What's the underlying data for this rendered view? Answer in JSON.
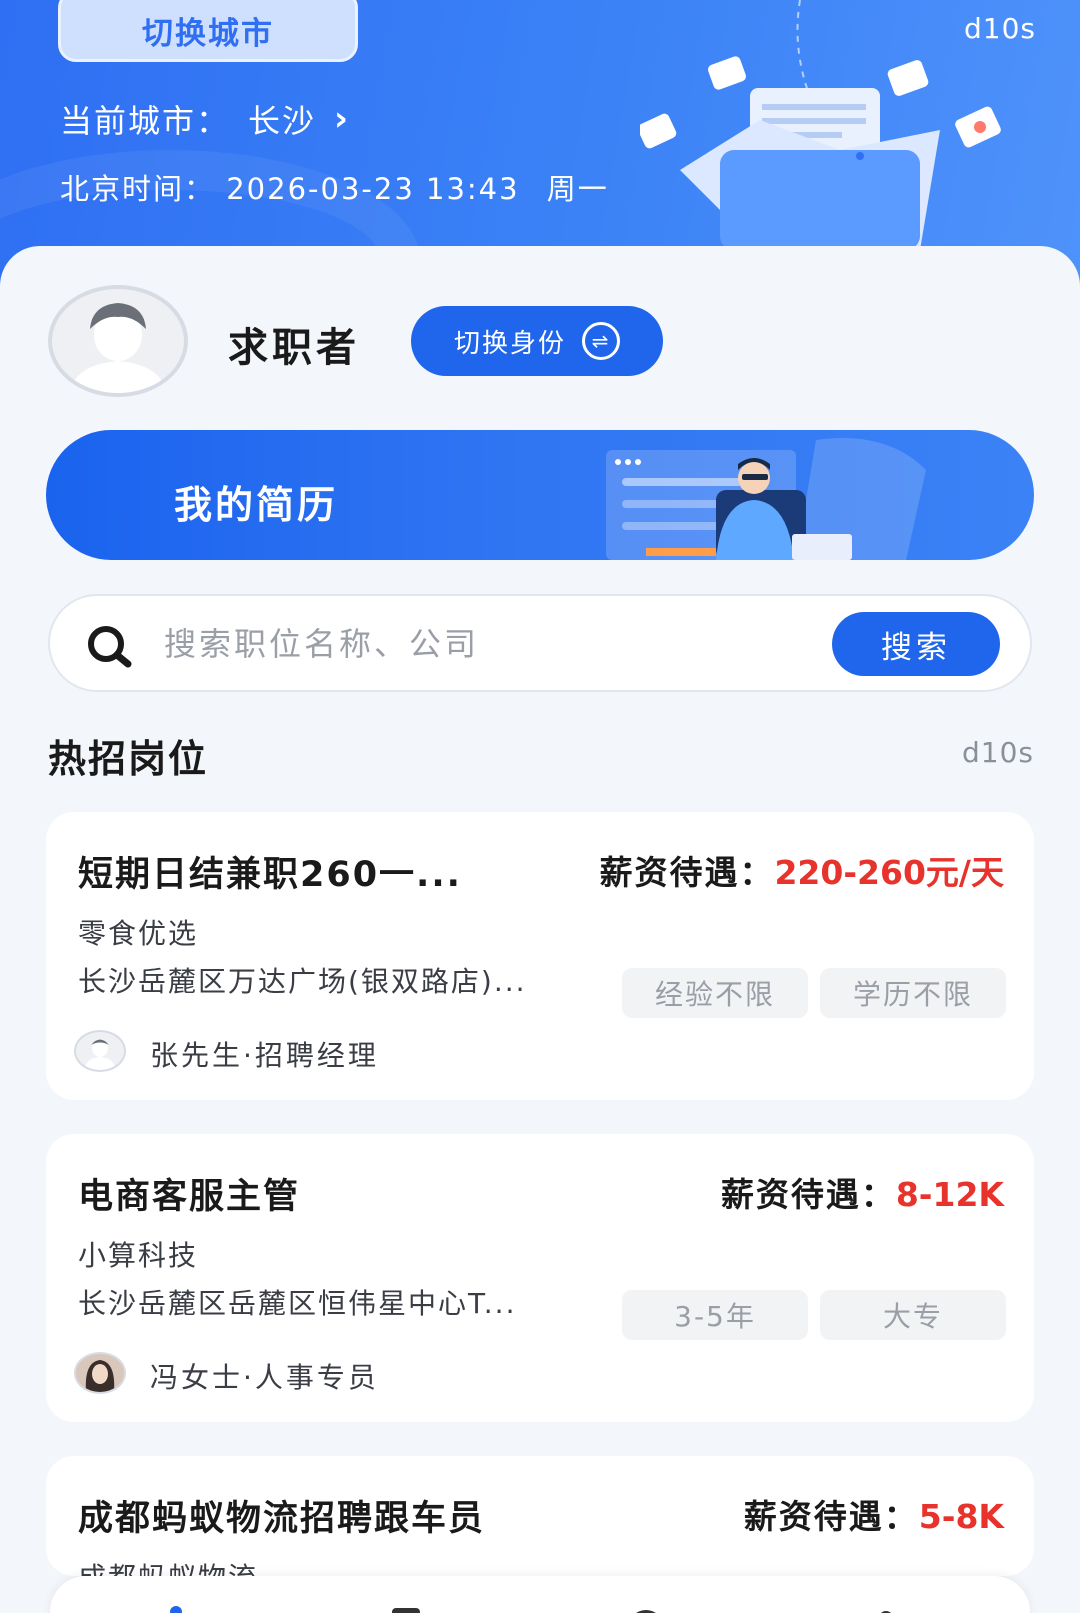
{
  "header": {
    "switch_city_label": "切换城市",
    "code": "d10s",
    "current_city_label": "当前城市：",
    "current_city": "长沙",
    "time_label": "北京时间：",
    "datetime": "2026-03-23 13:43",
    "weekday": "周一"
  },
  "profile": {
    "role": "求职者",
    "switch_identity_label": "切换身份"
  },
  "resume_banner": {
    "label": "我的简历"
  },
  "search": {
    "placeholder": "搜索职位名称、公司",
    "button_label": "搜索"
  },
  "hot_jobs": {
    "title": "热招岗位",
    "code": "d10s",
    "salary_label": "薪资待遇：",
    "jobs": [
      {
        "title": "短期日结兼职260一...",
        "salary": "220-260元/天",
        "company": "零食优选",
        "address": "长沙岳麓区万达广场(银双路店)...",
        "tags": [
          "经验不限",
          "学历不限"
        ],
        "recruiter": "张先生·招聘经理"
      },
      {
        "title": "电商客服主管",
        "salary": "8-12K",
        "company": "小算科技",
        "address": "长沙岳麓区岳麓区恒伟星中心T...",
        "tags": [
          "3-5年",
          "大专"
        ],
        "recruiter": "冯女士·人事专员"
      },
      {
        "title": "成都蚂蚁物流招聘跟车员",
        "salary": "5-8K",
        "company": "成都蚂蚁物流"
      }
    ]
  },
  "colors": {
    "brand_blue": "#1f66ec",
    "salary_red": "#e8322c"
  }
}
